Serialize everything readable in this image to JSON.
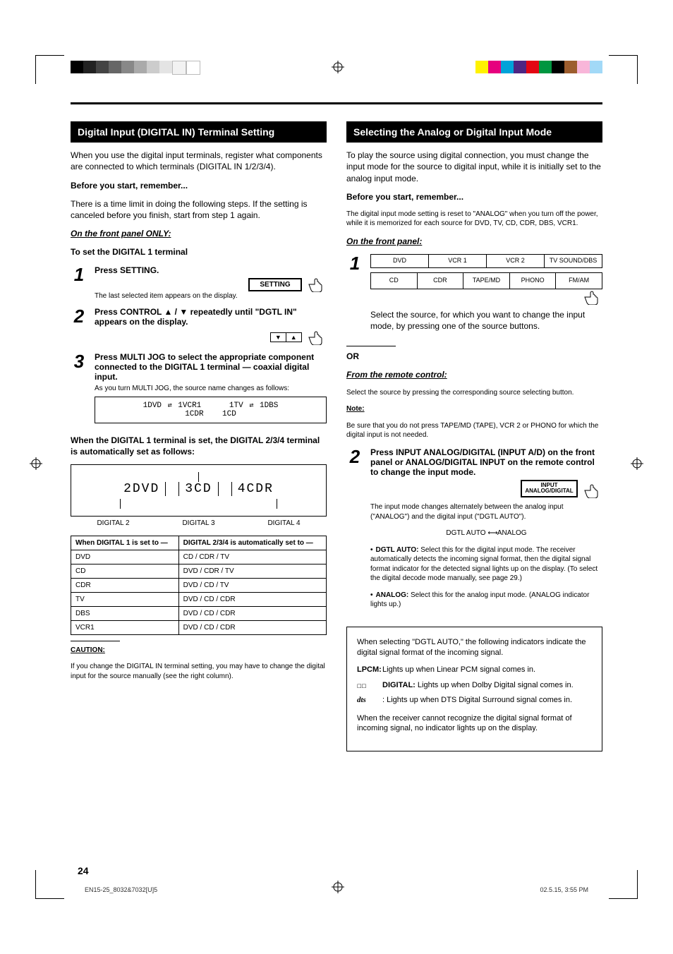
{
  "pageNumber": "24",
  "headings": {
    "left": "Digital Input (DIGITAL IN) Terminal Setting",
    "right": "Selecting the Analog or Digital Input Mode"
  },
  "left": {
    "intro1": "When you use the digital input terminals, register what components are connected to which terminals (DIGITAL IN 1/2/3/4).",
    "intro2": "Before you start, remember...",
    "intro3": "There is a time limit in doing the following steps. If the setting is canceled before you finish, start from step 1 again.",
    "frontOnly": "On the front panel ONLY:",
    "toSet": "To set the DIGITAL 1 terminal",
    "step1": "Press SETTING.",
    "step1sub": "The last selected item appears on the display.",
    "step2": "Press CONTROL ▲ / ▼ repeatedly until \"DGTL IN\" appears on the display.",
    "step3": "Press MULTI JOG to select the appropriate component connected to the DIGITAL 1 terminal — coaxial digital input.",
    "step3sub": "As you turn MULTI JOG, the source name changes as follows:",
    "displayRow1a": "1DVD",
    "displayRow1b": "1VCR1",
    "displayRow2a": "1TV",
    "displayRow2b": "1DBS",
    "displayRow3": "1CDR",
    "displayRow4": "1CD",
    "display_arrow": "↔",
    "autoHead": "When the DIGITAL 1 terminal is set, the DIGITAL 2/3/4 terminal is automatically set as follows:",
    "seg2": "2DVD",
    "seg3": "3CD",
    "seg4": "4CDR",
    "lab2": "DIGITAL 2",
    "lab3": "DIGITAL 3",
    "lab4": "DIGITAL 4",
    "mapHead1": "When DIGITAL 1 is set to —",
    "mapHead2": "DIGITAL 2/3/4 is automatically set to —",
    "map": [
      {
        "a": "DVD",
        "b": "CD / CDR / TV"
      },
      {
        "a": "CD",
        "b": "DVD / CDR / TV"
      },
      {
        "a": "CDR",
        "b": "DVD / CD / TV"
      },
      {
        "a": "TV",
        "b": "DVD / CD / CDR"
      },
      {
        "a": "DBS",
        "b": "DVD / CD / CDR"
      },
      {
        "a": "VCR1",
        "b": "DVD / CD / CDR"
      }
    ],
    "caution": "CAUTION:",
    "cautionText": "If you change the DIGITAL IN terminal setting, you may have to change the digital input for the source manually (see the right column)."
  },
  "right": {
    "intro": "To play the source using digital connection, you must change the input mode for the source to digital input, while it is initially set to the analog input mode.",
    "before": "Before you start, remember...",
    "beforeSub": "The digital input mode setting is reset to \"ANALOG\" when you turn off the power, while it is memorized for each source for DVD, TV, CD, CDR, DBS, VCR1.",
    "frontPanel": "On the front panel:",
    "panelCells1": [
      "DVD",
      "VCR 1",
      "VCR 2",
      "TV SOUND/DBS"
    ],
    "panelCells2": [
      "CD",
      "CDR",
      "TAPE/MD",
      "PHONO",
      "FM/AM"
    ],
    "step1": "Select the source, for which you want to change the input mode, by pressing one of the source buttons.",
    "or": "OR",
    "remoteHead": "From the remote control:",
    "remoteText": "Select the source by pressing the corresponding source selecting button.",
    "noteHead": "Note:",
    "noteText": "Be sure that you do not press TAPE/MD (TAPE), VCR 2 or PHONO for which the digital input is not needed.",
    "step2": "Press INPUT ANALOG/DIGITAL (INPUT A/D) on the front panel or ANALOG/DIGITAL INPUT on the remote control to change the input mode.",
    "step2sub1": "The input mode changes alternately between the analog input (\"ANALOG\") and the digital input (\"DGTL AUTO\").",
    "dgtlAuto": "DGTL AUTO",
    "analog": "ANALOG",
    "bullet1label": "DGTL AUTO:",
    "bullet1": "Select this for the digital input mode. The receiver automatically detects the incoming signal format, then the digital signal format indicator for the detected signal lights up on the display. (To select the digital decode mode manually, see page 29.)",
    "bullet2label": "ANALOG:",
    "bullet2": "Select this for the analog input mode. (ANALOG indicator lights up.)",
    "boxHead": "When selecting \"DGTL AUTO,\" the following indicators indicate the digital signal format of the incoming signal.",
    "lpcmLabel": "LPCM:",
    "lpcm": "Lights up when Linear PCM signal comes in.",
    "dolbyIcon": "☐☐",
    "dolbyLabel": "DIGITAL:",
    "dolby": "Lights up when Dolby Digital signal comes in.",
    "dtsIcon": "dts",
    "dts": ": Lights up when DTS Digital Surround signal comes in.",
    "boxNote": "When the receiver cannot recognize the digital signal format of incoming signal, no indicator lights up on the display."
  },
  "buttons": {
    "setting": "SETTING",
    "ctrlUp": "▼",
    "ctrlDn": "▲",
    "inputAD": "INPUT\nANALOG/DIGITAL"
  },
  "colorbars": {
    "gray": [
      "#000",
      "#222",
      "#444",
      "#666",
      "#888",
      "#aaa",
      "#ccc",
      "#eee",
      "#fff",
      "#fff"
    ],
    "color": [
      "#00a3d9",
      "#ff0",
      "#f0f",
      "#f00",
      "#0f0",
      "#00f",
      "#303",
      "#a42",
      "#f9c",
      "#9cf"
    ]
  },
  "filename": "EN15-25_8032&7032[U]5",
  "pagemeta": "02.5.15, 3:55 PM"
}
